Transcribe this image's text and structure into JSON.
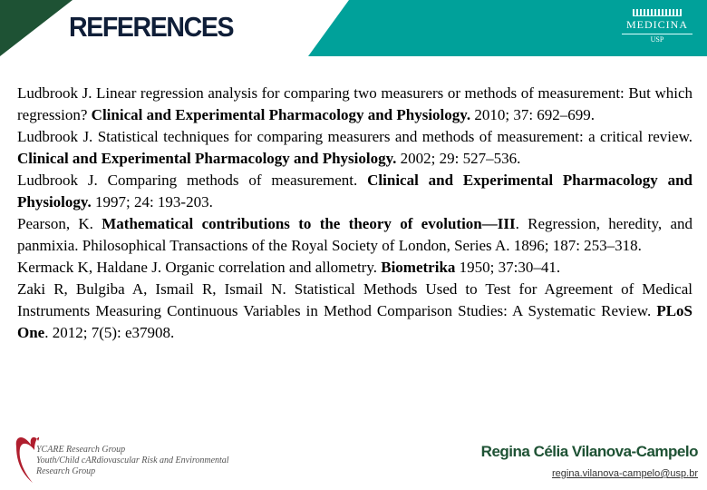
{
  "header": {
    "title": "REFERENCES",
    "logo": {
      "main": "MEDICINA",
      "sub": "USP"
    },
    "colors": {
      "dark_green": "#1e5234",
      "teal": "#00a19a"
    }
  },
  "references": [
    [
      {
        "t": "Ludbrook J. Linear regression analysis for comparing two measurers or methods of measurement: But which regression? "
      },
      {
        "t": "Clinical and Experimental Pharmacology and Physiology.",
        "b": true
      },
      {
        "t": " 2010; 37: 692–699."
      }
    ],
    [
      {
        "t": "Ludbrook J. Statistical techniques for comparing measurers and methods of measurement: a critical review. "
      },
      {
        "t": "Clinical and Experimental Pharmacology and Physiology.",
        "b": true
      },
      {
        "t": " 2002; 29: 527–536."
      }
    ],
    [
      {
        "t": "Ludbrook J. Comparing methods of measurement. "
      },
      {
        "t": "Clinical and Experimental Pharmacology and Physiology.",
        "b": true
      },
      {
        "t": " 1997; 24: 193-203."
      }
    ],
    [
      {
        "t": "Pearson, K. "
      },
      {
        "t": "Mathematical contributions to the theory of evolution—III",
        "b": true
      },
      {
        "t": ". Regression, heredity, and panmixia. Philosophical Transactions of the Royal Society of London, Series A. 1896; 187: 253–318."
      }
    ],
    [
      {
        "t": "Kermack K, Haldane J. Organic correlation and allometry. "
      },
      {
        "t": "Biometrika",
        "b": true
      },
      {
        "t": " 1950; 37:30–41."
      }
    ],
    [
      {
        "t": "Zaki R, Bulgiba A, Ismail R, Ismail N. Statistical Methods Used to Test for Agreement of Medical Instruments Measuring Continuous Variables in Method Comparison Studies: A Systematic Review. "
      },
      {
        "t": "PLoS One",
        "b": true
      },
      {
        "t": ". 2012; 7(5): e37908."
      }
    ]
  ],
  "footer": {
    "group_logo": [
      "YCARE Research Group",
      "Youth/Child cARdiovascular Risk and Environmental",
      "Research Group"
    ],
    "author": "Regina Célia Vilanova-Campelo",
    "email": "regina.vilanova-campelo@usp.br",
    "heart_color": "#b01e2e"
  }
}
